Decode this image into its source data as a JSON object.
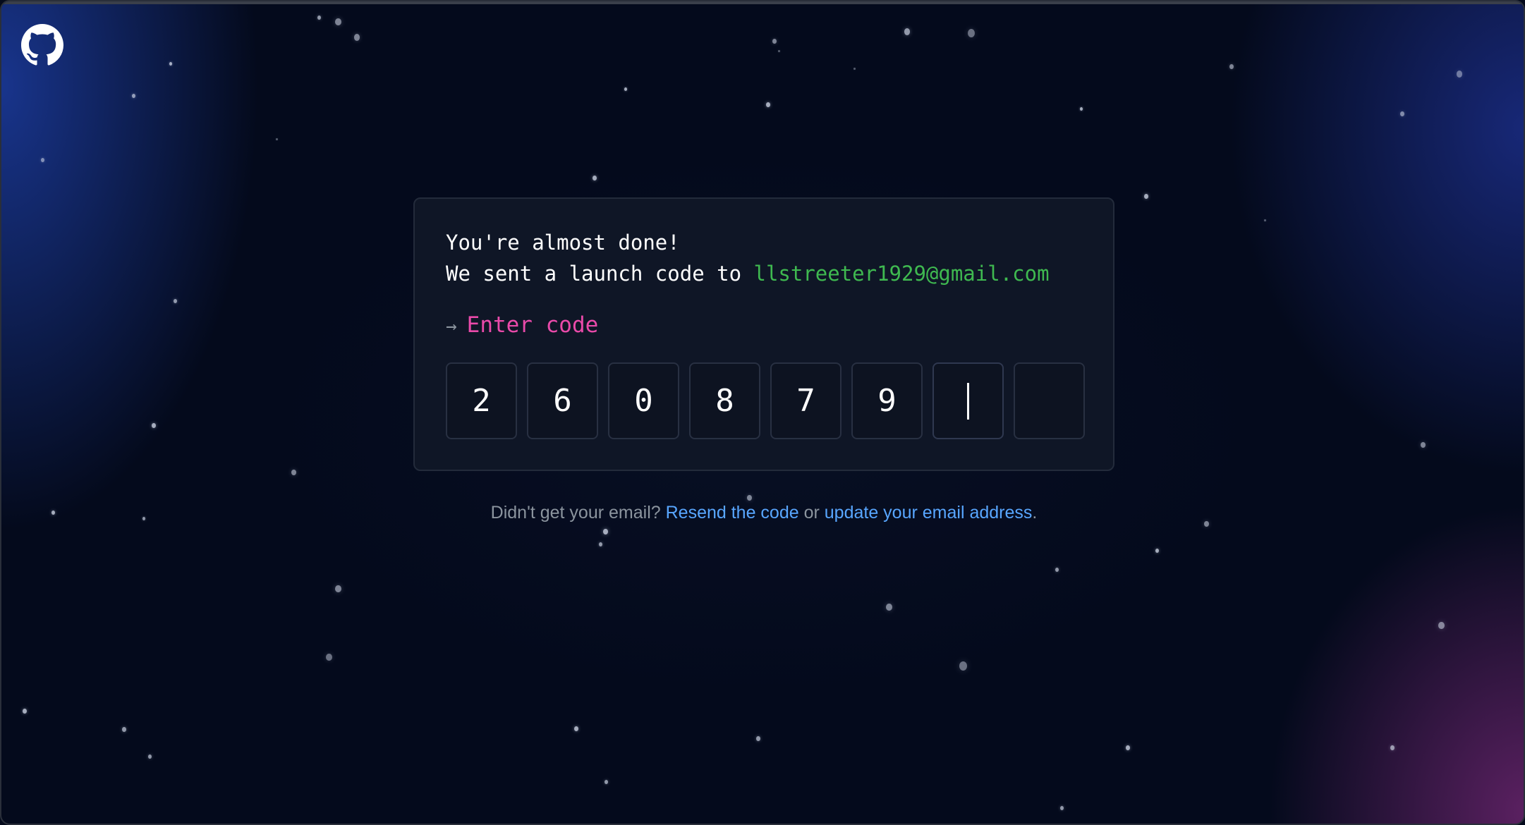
{
  "header": {
    "logo_icon": "github-octocat-icon"
  },
  "card": {
    "line1": "You're almost done!",
    "line2_prefix": "We sent a launch code to ",
    "email": "llstreeter1929@gmail.com",
    "prompt_arrow": "→",
    "prompt_label": "Enter code",
    "code_digits": [
      "2",
      "6",
      "0",
      "8",
      "7",
      "9",
      "",
      ""
    ]
  },
  "footer": {
    "prefix": "Didn't get your email? ",
    "resend_link": "Resend the code",
    "middle": " or ",
    "update_link": "update your email address",
    "suffix": "."
  },
  "colors": {
    "email_green": "#3fb950",
    "prompt_pink": "#ea4aaa",
    "link_blue": "#58a6ff",
    "muted_gray": "#8b949e",
    "background": "#040a1c"
  }
}
